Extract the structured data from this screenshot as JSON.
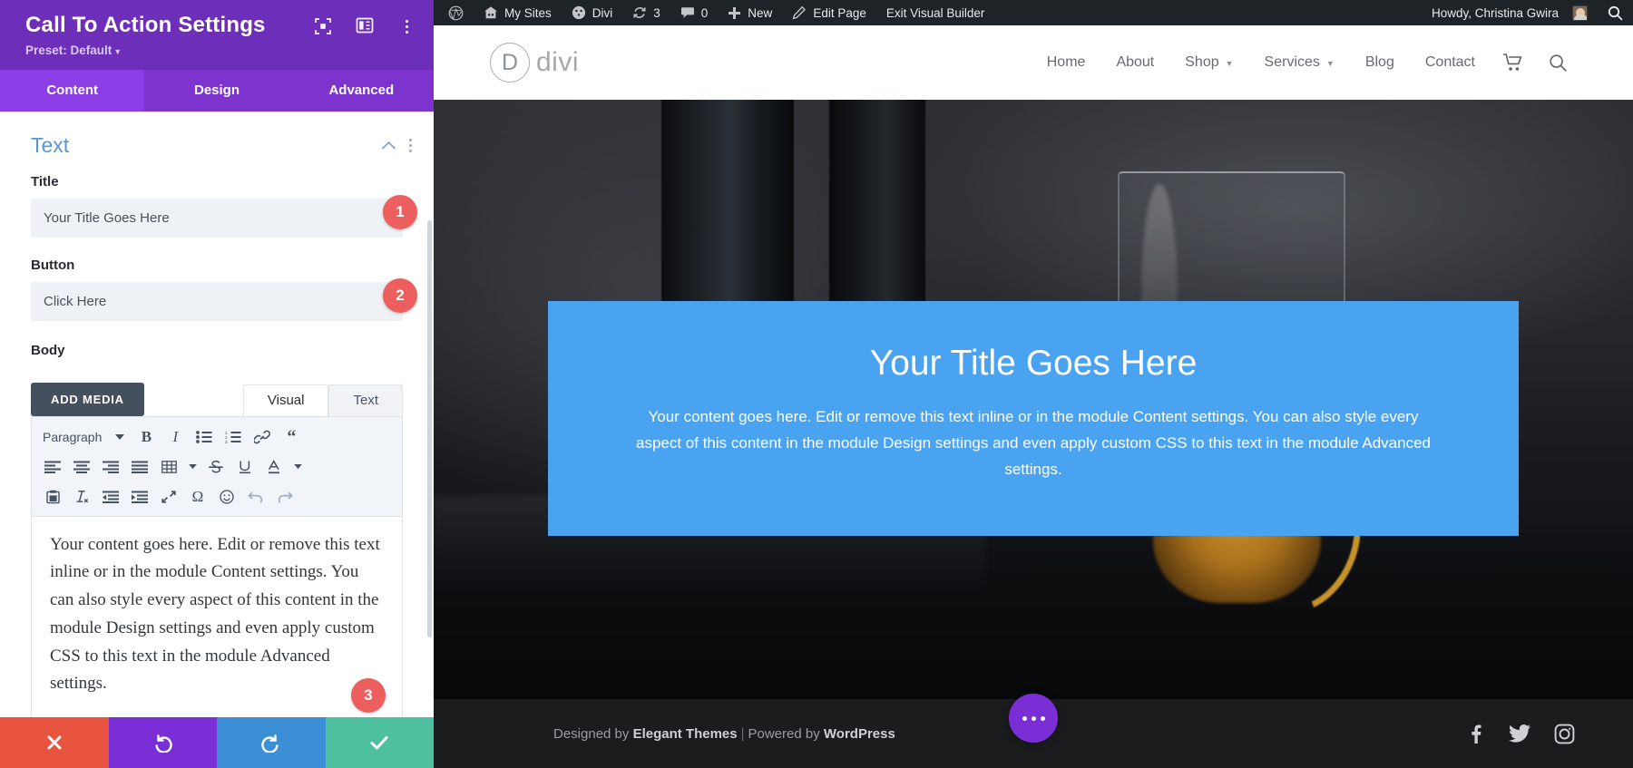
{
  "panel": {
    "title": "Call To Action Settings",
    "preset_label": "Preset: Default",
    "header_icons": [
      {
        "name": "focus-icon"
      },
      {
        "name": "layout-panel-icon"
      },
      {
        "name": "more-options-icon"
      }
    ],
    "tabs": [
      {
        "label": "Content",
        "active": true
      },
      {
        "label": "Design",
        "active": false
      },
      {
        "label": "Advanced",
        "active": false
      }
    ],
    "section": {
      "title": "Text",
      "collapse_icon": "chevron-up-icon",
      "options_icon": "more-options-icon"
    },
    "fields": {
      "title": {
        "label": "Title",
        "value": "Your Title Goes Here",
        "placeholder": "Your Title Goes Here",
        "badge": "1"
      },
      "button": {
        "label": "Button",
        "value": "Click Here",
        "placeholder": "Click Here",
        "badge": "2"
      },
      "body": {
        "label": "Body",
        "badge": "3",
        "add_media_label": "ADD MEDIA",
        "editor_tabs": [
          {
            "label": "Visual",
            "active": true
          },
          {
            "label": "Text",
            "active": false
          }
        ],
        "format_select": "Paragraph",
        "content": "Your content goes here. Edit or remove this text inline or in the module Content settings. You can also style every aspect of this content in the module Design settings and even apply custom CSS to this text in the module Advanced settings."
      }
    },
    "toolbar_row1": [
      {
        "name": "bold-icon",
        "label": "B"
      },
      {
        "name": "italic-icon",
        "label": "I"
      },
      {
        "name": "bulleted-list-icon",
        "label": ""
      },
      {
        "name": "numbered-list-icon",
        "label": ""
      },
      {
        "name": "link-icon",
        "label": ""
      },
      {
        "name": "blockquote-icon",
        "label": ""
      }
    ],
    "toolbar_row2": [
      {
        "name": "align-left-icon"
      },
      {
        "name": "align-center-icon"
      },
      {
        "name": "align-right-icon"
      },
      {
        "name": "align-justify-icon"
      },
      {
        "name": "table-icon"
      },
      {
        "name": "strikethrough-icon"
      },
      {
        "name": "underline-icon"
      },
      {
        "name": "text-color-icon"
      }
    ],
    "toolbar_row3": [
      {
        "name": "paste-as-text-icon"
      },
      {
        "name": "clear-formatting-icon"
      },
      {
        "name": "outdent-icon"
      },
      {
        "name": "indent-icon"
      },
      {
        "name": "fullscreen-icon"
      },
      {
        "name": "special-character-icon"
      },
      {
        "name": "emoji-icon"
      },
      {
        "name": "undo-icon"
      },
      {
        "name": "redo-icon"
      }
    ],
    "actions": [
      {
        "name": "cancel-button",
        "icon": "close-icon",
        "color": "#e8543f"
      },
      {
        "name": "undo-button",
        "icon": "undo-icon",
        "color": "#7a2ed6"
      },
      {
        "name": "redo-button",
        "icon": "redo-icon",
        "color": "#3d8fd5"
      },
      {
        "name": "save-button",
        "icon": "check-icon",
        "color": "#4ec09f"
      }
    ]
  },
  "adminbar": {
    "left_items": [
      {
        "label": "",
        "icon": "wordpress-logo-icon"
      },
      {
        "label": "My Sites",
        "icon": "sites-icon"
      },
      {
        "label": "Divi",
        "icon": "divi-dashboard-icon"
      },
      {
        "label": "3",
        "icon": "updates-icon"
      },
      {
        "label": "0",
        "icon": "comments-icon"
      },
      {
        "label": "New",
        "icon": "plus-icon"
      },
      {
        "label": "Edit Page",
        "icon": "pencil-icon"
      },
      {
        "label": "Exit Visual Builder",
        "icon": ""
      }
    ],
    "greeting": "Howdy, Christina Gwira",
    "avatar": "user-avatar",
    "search_icon": "search-icon"
  },
  "site": {
    "logo_letter": "D",
    "logo_text": "divi",
    "nav": [
      {
        "label": "Home",
        "has_dropdown": false
      },
      {
        "label": "About",
        "has_dropdown": false
      },
      {
        "label": "Shop",
        "has_dropdown": true
      },
      {
        "label": "Services",
        "has_dropdown": true
      },
      {
        "label": "Blog",
        "has_dropdown": false
      },
      {
        "label": "Contact",
        "has_dropdown": false
      }
    ],
    "cart_icon": "shopping-cart-icon",
    "search_icon": "search-icon"
  },
  "cta": {
    "title": "Your Title Goes Here",
    "body": "Your content goes here. Edit or remove this text inline or in the module Content settings. You can also style every aspect of this content in the module Design settings and even apply custom CSS to this text in the module Advanced settings.",
    "background_color": "#4aa3f0"
  },
  "footer": {
    "designed_by": "Designed by",
    "designed_by_brand": "Elegant Themes",
    "separator": "|",
    "powered_by": "Powered by",
    "powered_by_brand": "WordPress",
    "socials": [
      {
        "name": "facebook-icon"
      },
      {
        "name": "twitter-icon"
      },
      {
        "name": "instagram-icon"
      }
    ],
    "fab": "builder-menu-fab"
  }
}
